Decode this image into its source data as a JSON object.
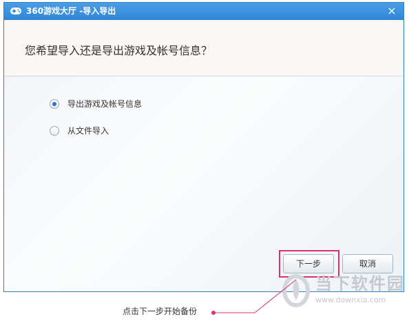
{
  "window": {
    "title": "360游戏大厅 -导入导出",
    "close_symbol": "×"
  },
  "header": {
    "question": "您希望导入还是导出游戏及帐号信息？"
  },
  "options": [
    {
      "label": "导出游戏及帐号信息",
      "selected": true
    },
    {
      "label": "从文件导入",
      "selected": false
    }
  ],
  "buttons": {
    "next_label": "下一步",
    "cancel_label": "取消"
  },
  "annotation": {
    "text": "点击下一步开始备份",
    "color": "#e0306a"
  },
  "watermark": {
    "name": "当下软件园",
    "url": "www.downxia.com"
  },
  "colors": {
    "titlebar": "#2f86d6",
    "accent": "#e0306a"
  }
}
